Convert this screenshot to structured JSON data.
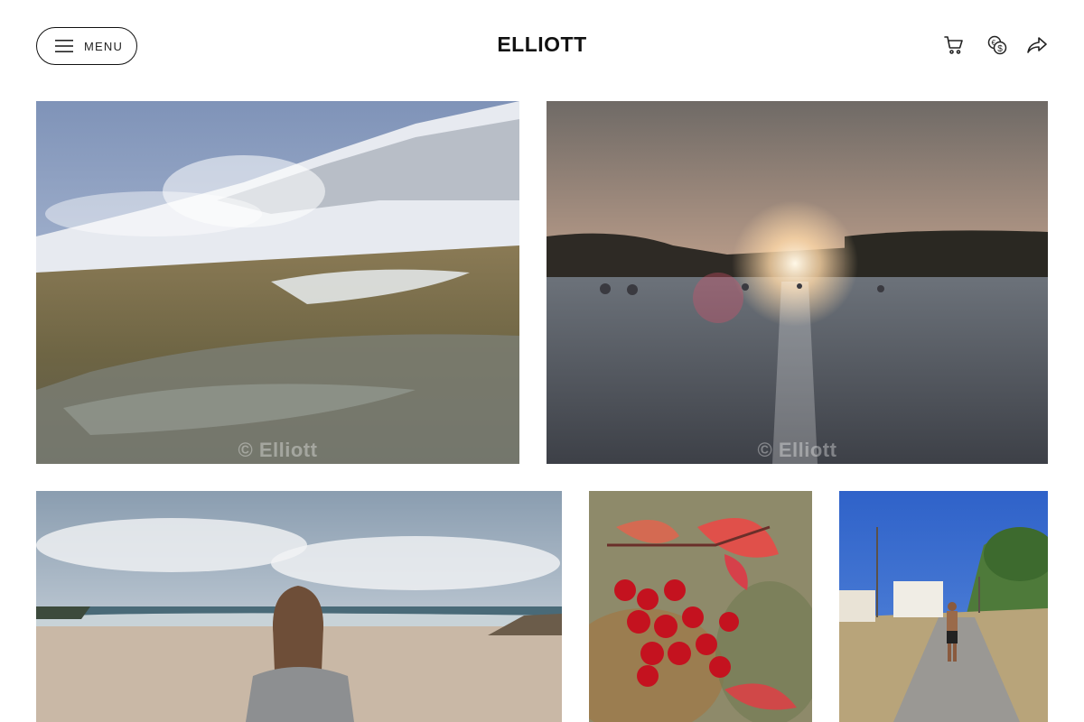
{
  "header": {
    "menu_label": "MENU",
    "brand_name": "ELLIOTT",
    "icons": [
      "cart-icon",
      "currency-icon",
      "share-icon"
    ]
  },
  "gallery": {
    "watermark_text": "© Elliott",
    "photos": [
      {
        "subject": "geothermal-steam-snowy-mountains"
      },
      {
        "subject": "sunset-over-hot-spring-lagoon"
      },
      {
        "subject": "woman-on-beach"
      },
      {
        "subject": "red-berries-on-branch"
      },
      {
        "subject": "man-walking-on-sunny-road"
      }
    ]
  },
  "colors": {
    "text": "#111111",
    "background": "#ffffff",
    "border": "#111111"
  }
}
